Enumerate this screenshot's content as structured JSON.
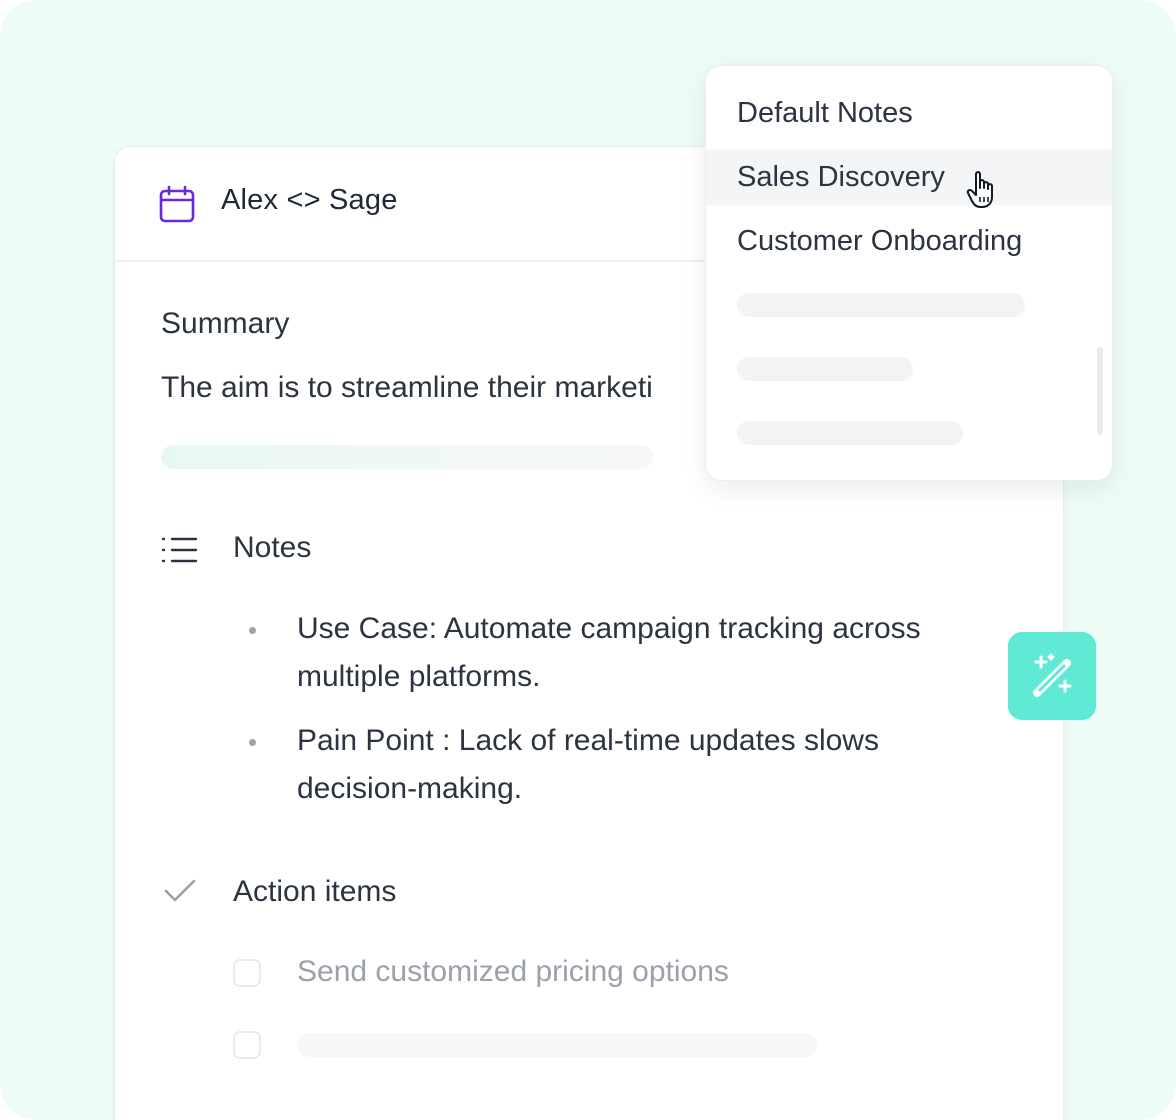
{
  "meeting": {
    "title": "Alex <> Sage",
    "calendar_icon": "calendar-icon"
  },
  "summary": {
    "heading": "Summary",
    "text": "The aim is to streamline their marketi"
  },
  "notes": {
    "heading": "Notes",
    "icon": "list-icon",
    "items": [
      {
        "line1": "Use Case: Automate campaign tracking across",
        "line2": "multiple platforms."
      },
      {
        "line1": "Pain Point : Lack of real-time updates slows",
        "line2": "decision-making."
      }
    ]
  },
  "action_items": {
    "heading": "Action items",
    "icon": "check-icon",
    "items": [
      {
        "label": "Send customized pricing options",
        "checked": false
      }
    ]
  },
  "template_menu": {
    "items": [
      {
        "label": "Default Notes"
      },
      {
        "label": "Sales Discovery",
        "hovered": true
      },
      {
        "label": "Customer Onboarding"
      }
    ]
  },
  "magic_button": {
    "icon": "magic-wand-icon",
    "color": "#5EEAD4"
  },
  "colors": {
    "background": "#EEFCF6",
    "accent_purple": "#7C3AED",
    "text": "#2B3440",
    "muted_text": "#9AA1AB"
  }
}
